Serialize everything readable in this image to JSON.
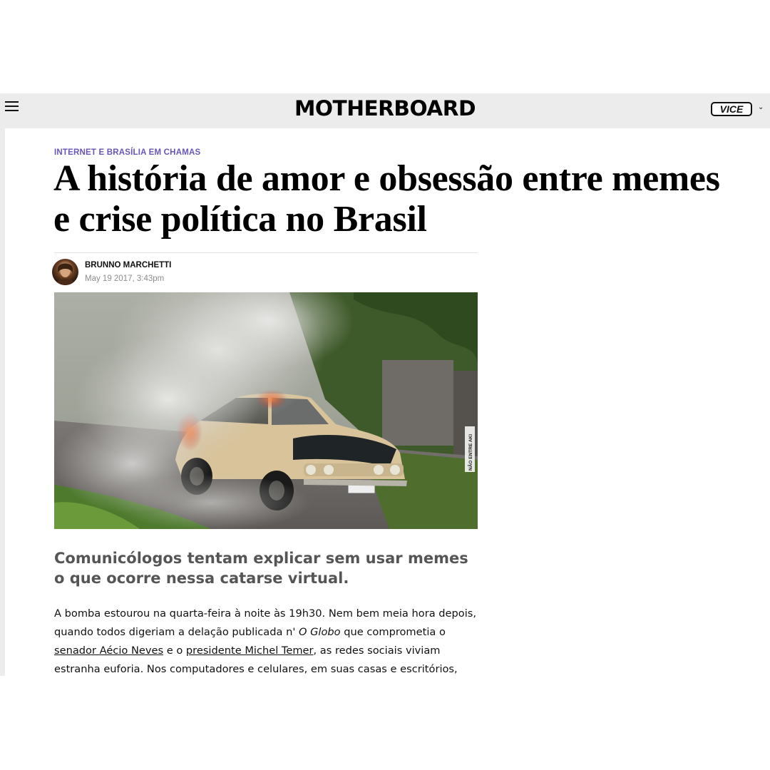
{
  "header": {
    "logo": "MOTHERBOARD",
    "vice_logo": "VICE",
    "menu_icon": "hamburger-menu-icon",
    "dropdown_icon": "chevron-down-icon"
  },
  "article": {
    "kicker": "INTERNET E BRASÍLIA EM CHAMAS",
    "headline": "A história de amor e obsessão entre memes e crise política no Brasil",
    "author": "BRUNNO MARCHETTI",
    "date": "May 19 2017, 3:43pm",
    "hero_watermark": "NÃO ENTRE AKI",
    "dek": "Comunicólogos tentam explicar sem usar memes o que ocorre nessa catarse virtual.",
    "body": {
      "p1_a": "A bomba estourou na quarta-feira à noite às 19h30. Nem bem meia hora depois, quando todos digeriam a delação publicada n' ",
      "p1_globo": "O Globo",
      "p1_b": " que comprometia o ",
      "p1_link1": "senador Aécio Neves",
      "p1_c": " e o ",
      "p1_link2": "presidente Michel Temer",
      "p1_d": ", as redes sociais viviam estranha euforia. Nos computadores e celulares, em suas casas e escritórios,"
    }
  },
  "colors": {
    "kicker": "#6a55b8",
    "topbar": "#ececec",
    "dek": "#555555"
  }
}
